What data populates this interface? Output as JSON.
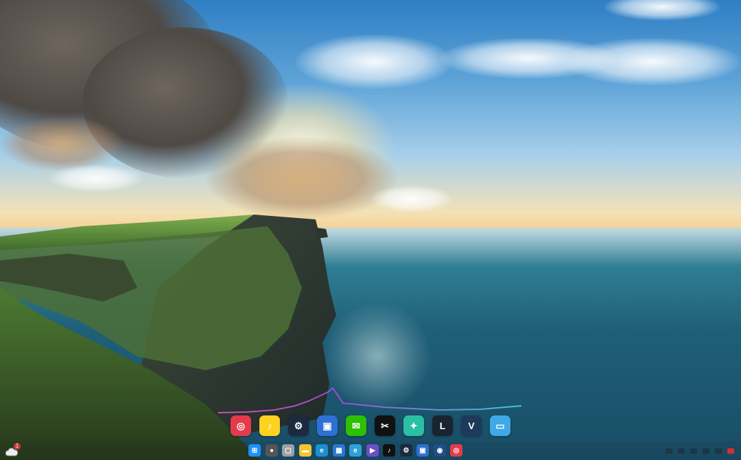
{
  "wallpaper": {
    "description_colors": {
      "sky_top": "#2f7fc4",
      "horizon": "#f6d59a",
      "sea": "#1f5f78",
      "grass": "#4f8a3a"
    }
  },
  "dock": {
    "apps": [
      {
        "name": "netease-music",
        "icon": "netease-music-icon",
        "color": "#e43a4b",
        "glyph": "◎"
      },
      {
        "name": "qq-music",
        "icon": "qq-music-icon",
        "color": "#ffd21f",
        "glyph": "♪"
      },
      {
        "name": "steam",
        "icon": "steam-icon",
        "color": "#1b2a40",
        "glyph": "⚙"
      },
      {
        "name": "screen-capture",
        "icon": "screen-capture-icon",
        "color": "#2f6fd6",
        "glyph": "▣"
      },
      {
        "name": "wechat",
        "icon": "wechat-icon",
        "color": "#2dc100",
        "glyph": "✉"
      },
      {
        "name": "capcut",
        "icon": "capcut-icon",
        "color": "#111111",
        "glyph": "✂"
      },
      {
        "name": "teal-app",
        "icon": "teal-app-icon",
        "color": "#2bbfa4",
        "glyph": "✦"
      },
      {
        "name": "league-of-legends",
        "icon": "league-icon",
        "color": "#1a2430",
        "glyph": "L"
      },
      {
        "name": "v-app",
        "icon": "v-app-icon",
        "color": "#1e3a5a",
        "glyph": "V"
      },
      {
        "name": "desktop",
        "icon": "monitor-icon",
        "color": "#3fa9e8",
        "glyph": "▭"
      }
    ]
  },
  "taskbar": {
    "items": [
      {
        "name": "start",
        "icon": "windows-start-icon",
        "color": "#1e90ff",
        "glyph": "⊞"
      },
      {
        "name": "search",
        "icon": "search-icon",
        "color": "#555555",
        "glyph": "●"
      },
      {
        "name": "task-view",
        "icon": "task-view-icon",
        "color": "#9aa0a6",
        "glyph": "▢"
      },
      {
        "name": "file-explorer",
        "icon": "folder-icon",
        "color": "#f4c430",
        "glyph": "▬"
      },
      {
        "name": "edge",
        "icon": "edge-icon",
        "color": "#1b8fd1",
        "glyph": "e"
      },
      {
        "name": "store",
        "icon": "store-icon",
        "color": "#2b78d6",
        "glyph": "▦"
      },
      {
        "name": "edge-2",
        "icon": "browser-icon",
        "color": "#2aa3d8",
        "glyph": "e"
      },
      {
        "name": "media",
        "icon": "media-icon",
        "color": "#6b4fc8",
        "glyph": "▶"
      },
      {
        "name": "tiktok",
        "icon": "tiktok-icon",
        "color": "#111111",
        "glyph": "♪"
      },
      {
        "name": "steam",
        "icon": "steam-icon",
        "color": "#1b2a40",
        "glyph": "⚙"
      },
      {
        "name": "screen-capture",
        "icon": "screen-capture-icon",
        "color": "#2f6fd6",
        "glyph": "▣"
      },
      {
        "name": "vpn",
        "icon": "vpn-icon",
        "color": "#1e4f8a",
        "glyph": "◉"
      },
      {
        "name": "netease-music",
        "icon": "netease-music-icon",
        "color": "#e43a4b",
        "glyph": "◎"
      }
    ]
  },
  "weather_widget": {
    "icon": "cloud-icon",
    "badge": "1"
  },
  "tray": {
    "icons": [
      "cloud-tray-icon",
      "network-icon",
      "volume-icon",
      "battery-icon",
      "input-icon",
      "notification-icon"
    ]
  }
}
